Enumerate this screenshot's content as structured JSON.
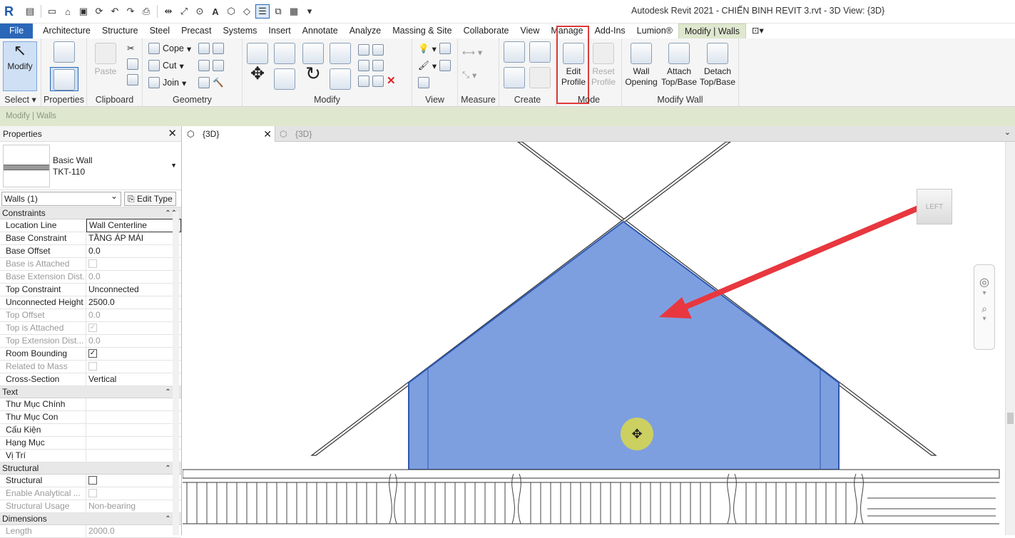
{
  "app": {
    "logo_letter": "R",
    "window_title": "Autodesk Revit 2021 - CHIẾN BINH REVIT 3.rvt - 3D View: {3D}"
  },
  "menu_tabs": [
    {
      "label": "File"
    },
    {
      "label": "Architecture"
    },
    {
      "label": "Structure"
    },
    {
      "label": "Steel"
    },
    {
      "label": "Precast"
    },
    {
      "label": "Systems"
    },
    {
      "label": "Insert"
    },
    {
      "label": "Annotate"
    },
    {
      "label": "Analyze"
    },
    {
      "label": "Massing & Site"
    },
    {
      "label": "Collaborate"
    },
    {
      "label": "View"
    },
    {
      "label": "Manage"
    },
    {
      "label": "Add-Ins"
    },
    {
      "label": "Lumion®"
    },
    {
      "label": "Modify | Walls"
    }
  ],
  "ribbon": {
    "select": {
      "modify": "Modify",
      "label": "Select ▾"
    },
    "properties": {
      "label": "Properties"
    },
    "clipboard": {
      "paste": "Paste",
      "label": "Clipboard"
    },
    "geometry": {
      "cope": "Cope",
      "cut": "Cut",
      "join": "Join",
      "label": "Geometry"
    },
    "modify": {
      "label": "Modify"
    },
    "view": {
      "label": "View"
    },
    "measure": {
      "label": "Measure"
    },
    "create": {
      "label": "Create"
    },
    "mode": {
      "edit_profile_1": "Edit",
      "edit_profile_2": "Profile",
      "reset_profile_1": "Reset",
      "reset_profile_2": "Profile",
      "label": "Mode"
    },
    "modify_wall": {
      "wall_opening_1": "Wall",
      "wall_opening_2": "Opening",
      "attach_1": "Attach",
      "attach_2": "Top/Base",
      "detach_1": "Detach",
      "detach_2": "Top/Base",
      "label": "Modify Wall"
    }
  },
  "context_bar": "Modify | Walls",
  "properties_panel": {
    "title": "Properties",
    "type_name_1": "Basic Wall",
    "type_name_2": "TKT-110",
    "instance_filter": "Walls (1)",
    "edit_type": "Edit Type",
    "groups": {
      "constraints": "Constraints",
      "text": "Text",
      "structural": "Structural",
      "dimensions": "Dimensions"
    },
    "constraints": [
      {
        "k": "Location Line",
        "v": "Wall Centerline"
      },
      {
        "k": "Base Constraint",
        "v": "TẦNG ÁP MÁI"
      },
      {
        "k": "Base Offset",
        "v": "0.0"
      },
      {
        "k": "Base is Attached",
        "v": ""
      },
      {
        "k": "Base Extension Dist...",
        "v": "0.0"
      },
      {
        "k": "Top Constraint",
        "v": "Unconnected"
      },
      {
        "k": "Unconnected Height",
        "v": "2500.0"
      },
      {
        "k": "Top Offset",
        "v": "0.0"
      },
      {
        "k": "Top is Attached",
        "v": ""
      },
      {
        "k": "Top Extension Dist...",
        "v": "0.0"
      },
      {
        "k": "Room Bounding",
        "v": ""
      },
      {
        "k": "Related to Mass",
        "v": ""
      },
      {
        "k": "Cross-Section",
        "v": "Vertical"
      }
    ],
    "text": [
      {
        "k": "Thư Mục Chính",
        "v": ""
      },
      {
        "k": "Thư Mục Con",
        "v": ""
      },
      {
        "k": "Cấu Kiện",
        "v": ""
      },
      {
        "k": "Hạng Mục",
        "v": ""
      },
      {
        "k": "Vị Trí",
        "v": ""
      }
    ],
    "structural": [
      {
        "k": "Structural",
        "v": ""
      },
      {
        "k": "Enable Analytical ...",
        "v": ""
      },
      {
        "k": "Structural Usage",
        "v": "Non-bearing"
      }
    ],
    "dimensions": [
      {
        "k": "Length",
        "v": "2000.0"
      }
    ]
  },
  "view_tabs": [
    {
      "label": "{3D}"
    },
    {
      "label": "{3D}"
    }
  ],
  "viewcube_face": "LEFT",
  "colors": {
    "file_tab": "#2a67b8",
    "context_green": "#dfe8cf",
    "wall_fill": "#7d9fe0",
    "wall_edge": "#2d58b0",
    "arrow": "#e8373f",
    "highlight_box": "#e03a3a",
    "cursor_halo": "#d9d84a"
  },
  "icons": [
    "revit-logo-icon",
    "new-icon",
    "open-icon",
    "save-icon",
    "sync-icon",
    "undo-icon",
    "redo-icon",
    "print-icon",
    "measure-icon",
    "dimension-icon",
    "tag-icon",
    "text-icon",
    "3d-view-icon",
    "section-icon",
    "thin-lines-icon",
    "close-windows-icon",
    "switch-windows-icon",
    "dropdown-icon",
    "move-cursor-icon",
    "arrow-annotation-icon"
  ]
}
